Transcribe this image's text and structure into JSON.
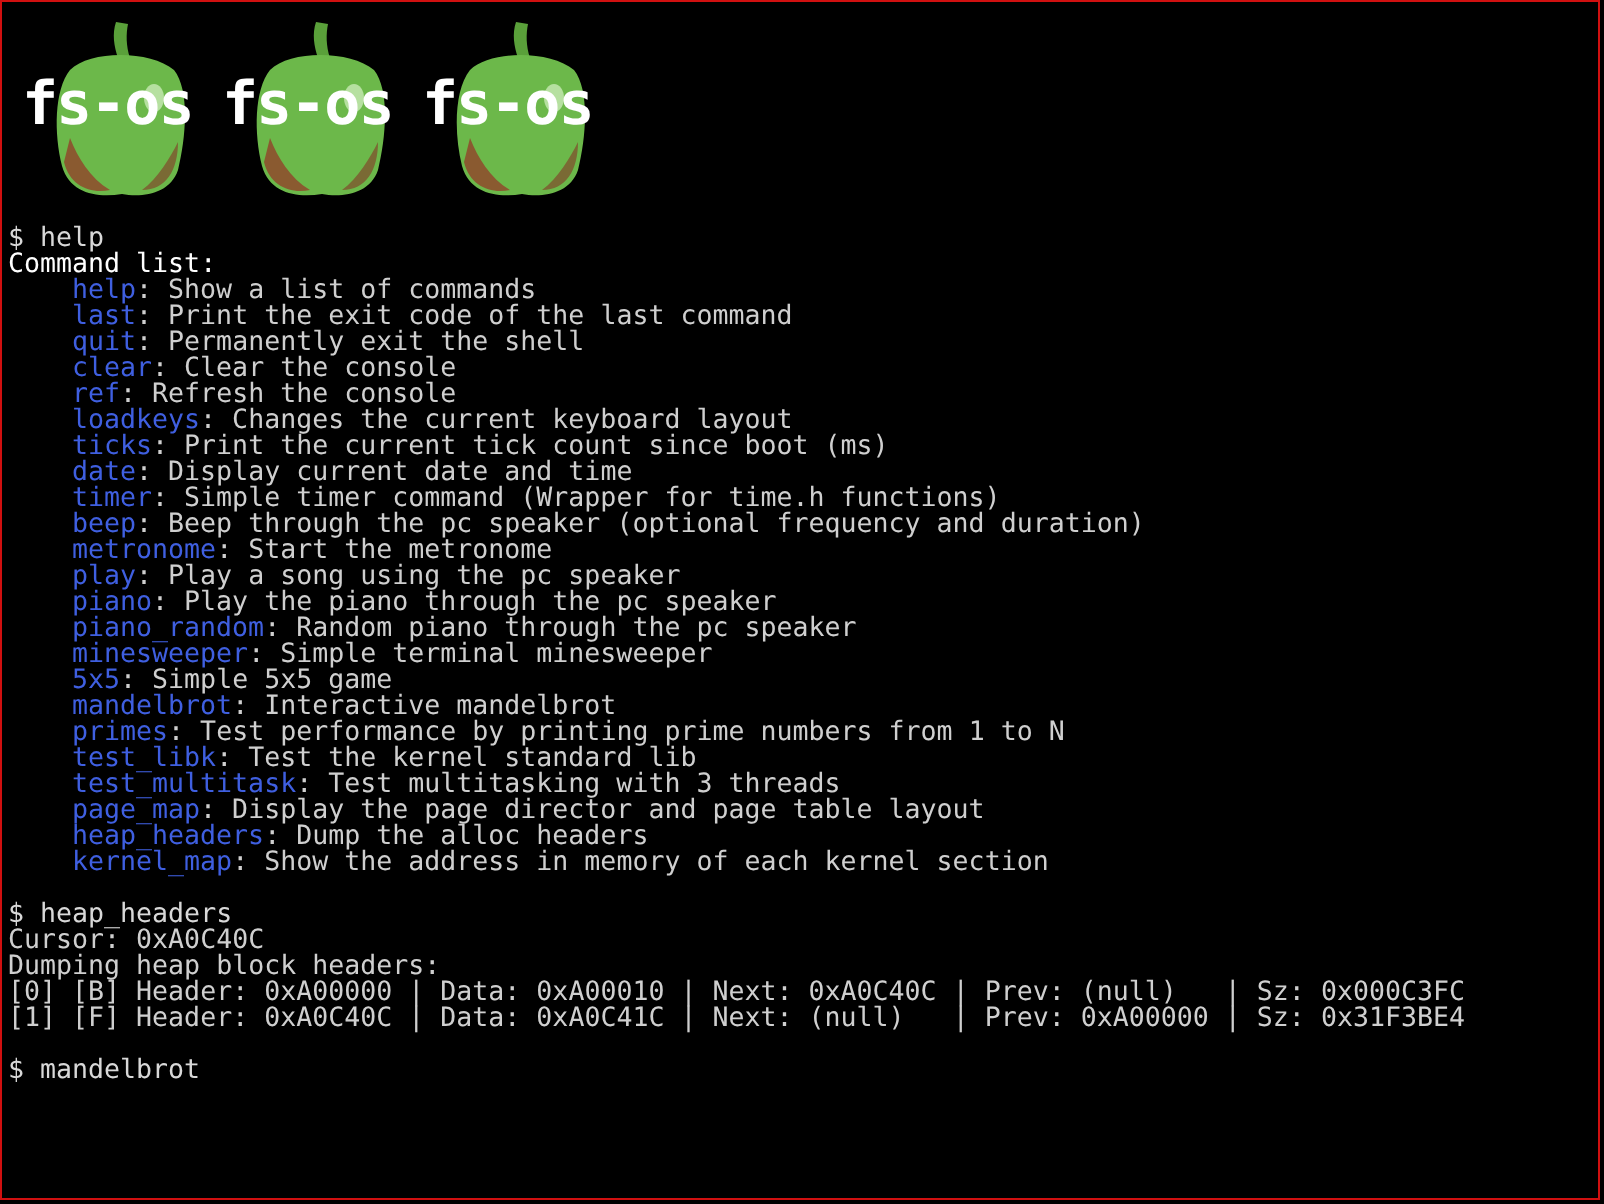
{
  "logo": {
    "items": [
      "fs-os",
      "fs-os",
      "fs-os"
    ]
  },
  "blocks": [
    {
      "prompt": "$",
      "command": "help",
      "output": [
        {
          "kind": "heading",
          "text": "Command list:"
        },
        {
          "kind": "entry",
          "name": "help",
          "description": ": Show a list of commands"
        },
        {
          "kind": "entry",
          "name": "last",
          "description": ": Print the exit code of the last command"
        },
        {
          "kind": "entry",
          "name": "quit",
          "description": ": Permanently exit the shell"
        },
        {
          "kind": "entry",
          "name": "clear",
          "description": ": Clear the console"
        },
        {
          "kind": "entry",
          "name": "ref",
          "description": ": Refresh the console"
        },
        {
          "kind": "entry",
          "name": "loadkeys",
          "description": ": Changes the current keyboard layout"
        },
        {
          "kind": "entry",
          "name": "ticks",
          "description": ": Print the current tick count since boot (ms)"
        },
        {
          "kind": "entry",
          "name": "date",
          "description": ": Display current date and time"
        },
        {
          "kind": "entry",
          "name": "timer",
          "description": ": Simple timer command (Wrapper for time.h functions)"
        },
        {
          "kind": "entry",
          "name": "beep",
          "description": ": Beep through the pc speaker (optional frequency and duration)"
        },
        {
          "kind": "entry",
          "name": "metronome",
          "description": ": Start the metronome"
        },
        {
          "kind": "entry",
          "name": "play",
          "description": ": Play a song using the pc speaker"
        },
        {
          "kind": "entry",
          "name": "piano",
          "description": ": Play the piano through the pc speaker"
        },
        {
          "kind": "entry",
          "name": "piano_random",
          "description": ": Random piano through the pc speaker"
        },
        {
          "kind": "entry",
          "name": "minesweeper",
          "description": ": Simple terminal minesweeper"
        },
        {
          "kind": "entry",
          "name": "5x5",
          "description": ": Simple 5x5 game"
        },
        {
          "kind": "entry",
          "name": "mandelbrot",
          "description": ": Interactive mandelbrot"
        },
        {
          "kind": "entry",
          "name": "primes",
          "description": ": Test performance by printing prime numbers from 1 to N"
        },
        {
          "kind": "entry",
          "name": "test_libk",
          "description": ": Test the kernel standard lib"
        },
        {
          "kind": "entry",
          "name": "test_multitask",
          "description": ": Test multitasking with 3 threads"
        },
        {
          "kind": "entry",
          "name": "page_map",
          "description": ": Display the page director and page table layout"
        },
        {
          "kind": "entry",
          "name": "heap_headers",
          "description": ": Dump the alloc headers"
        },
        {
          "kind": "entry",
          "name": "kernel_map",
          "description": ": Show the address in memory of each kernel section"
        }
      ]
    },
    {
      "prompt": "$",
      "command": "heap_headers",
      "output": [
        {
          "kind": "text",
          "text": "Cursor: 0xA0C40C"
        },
        {
          "kind": "text",
          "text": "Dumping heap block headers:"
        },
        {
          "kind": "text",
          "text": "[0] [B] Header: 0xA00000 | Data: 0xA00010 | Next: 0xA0C40C | Prev: (null)   | Sz: 0x000C3FC"
        },
        {
          "kind": "text",
          "text": "[1] [F] Header: 0xA0C40C | Data: 0xA0C41C | Next: (null)   | Prev: 0xA00000 | Sz: 0x31F3BE4"
        }
      ]
    },
    {
      "prompt": "$",
      "command": "mandelbrot"
    }
  ]
}
